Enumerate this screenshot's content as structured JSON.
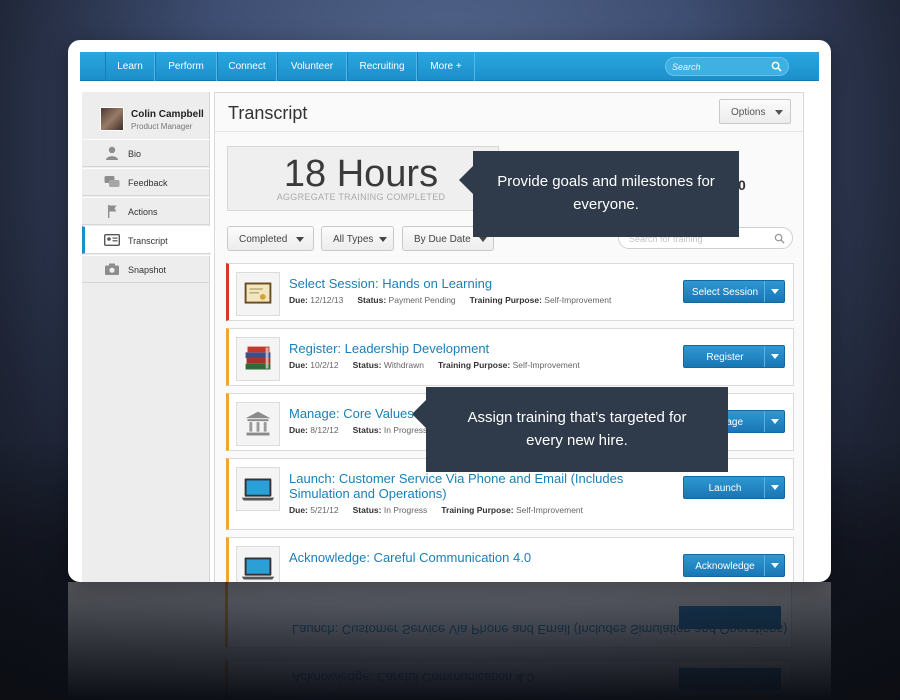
{
  "nav": {
    "items": [
      "Learn",
      "Perform",
      "Connect",
      "Volunteer",
      "Recruiting",
      "More +"
    ],
    "search_placeholder": "Search"
  },
  "profile": {
    "name": "Colin Campbell",
    "role": "Product Manager"
  },
  "sidebar": {
    "items": [
      {
        "label": "Bio",
        "icon": "person-icon"
      },
      {
        "label": "Feedback",
        "icon": "chat-bubbles-icon"
      },
      {
        "label": "Actions",
        "icon": "flag-icon"
      },
      {
        "label": "Transcript",
        "icon": "id-card-icon",
        "active": true
      },
      {
        "label": "Snapshot",
        "icon": "camera-icon"
      }
    ]
  },
  "main": {
    "title": "Transcript",
    "options_label": "Options",
    "hours_value": "18 Hours",
    "hours_label": "AGGREGATE TRAINING COMPLETED",
    "partial_value": "0",
    "filters": {
      "status": "Completed",
      "types": "All Types",
      "sort": "By Due Date"
    },
    "training_search_placeholder": "Search for training"
  },
  "trainings": [
    {
      "title": "Select Session: Hands on Learning",
      "due_label": "Due:",
      "due": "12/12/13",
      "status_label": "Status:",
      "status": "Payment Pending",
      "purpose_label": "Training Purpose:",
      "purpose": "Self-Improvement",
      "action": "Select Session",
      "icon": "certificate-icon",
      "accent": "#d9372e"
    },
    {
      "title": "Register: Leadership Development",
      "due_label": "Due:",
      "due": "10/2/12",
      "status_label": "Status:",
      "status": "Withdrawn",
      "purpose_label": "Training Purpose:",
      "purpose": "Self-Improvement",
      "action": "Register",
      "icon": "books-icon",
      "accent": "#f0a531"
    },
    {
      "title": "Manage: Core Values",
      "due_label": "Due:",
      "due": "8/12/12",
      "status_label": "Status:",
      "status": "In Progress",
      "purpose_label": "Training Purpose:",
      "purpose": "",
      "action": "Manage",
      "icon": "institution-icon",
      "accent": "#f0a531"
    },
    {
      "title": "Launch: Customer Service Via Phone and Email (Includes Simulation and Operations)",
      "due_label": "Due:",
      "due": "5/21/12",
      "status_label": "Status:",
      "status": "In Progress",
      "purpose_label": "Training Purpose:",
      "purpose": "Self-Improvement",
      "action": "Launch",
      "icon": "laptop-icon",
      "accent": "#f0a531"
    },
    {
      "title": "Acknowledge: Careful Communication 4.0",
      "action": "Acknowledge",
      "icon": "laptop-icon",
      "accent": "#f0a531"
    }
  ],
  "callouts": {
    "goals": "Provide goals and milestones for everyone.",
    "assign": "Assign training that’s targeted for every new hire."
  },
  "colors": {
    "nav_blue": "#1c8fcb",
    "link_blue": "#1a7fb9",
    "button_blue": "#1976b4",
    "callout_bg": "#2f3b4b",
    "accent_orange": "#f0a531",
    "accent_red": "#d9372e"
  }
}
